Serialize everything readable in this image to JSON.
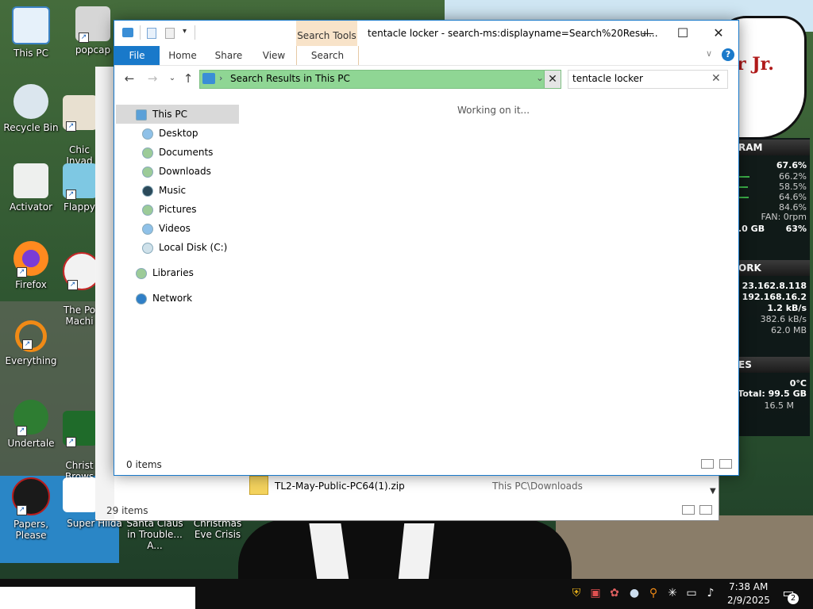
{
  "desktop": {
    "icons": [
      {
        "label": "This PC"
      },
      {
        "label": "popcap"
      },
      {
        "label": "Recycle Bin"
      },
      {
        "label": "Chic\nInvad"
      },
      {
        "label": "Activator"
      },
      {
        "label": "Flappy"
      },
      {
        "label": "Firefox"
      },
      {
        "label": "The Po\nMachi"
      },
      {
        "label": "Everything"
      },
      {
        "label": "Undertale"
      },
      {
        "label": "Christ\nBrows"
      },
      {
        "label": "Papers, Please"
      },
      {
        "label": "Super Hilda"
      },
      {
        "label": "Santa Claus in Trouble... A..."
      },
      {
        "label": "Christmas Eve Crisis"
      }
    ],
    "wallpaper_text": "r Jr."
  },
  "gadget": {
    "ram_header": "RAM",
    "ram_values": [
      "67.6%",
      "66.2%",
      "58.5%",
      "64.6%",
      "84.6%"
    ],
    "fan": "FAN: 0rpm",
    "ram_total": ".0 GB",
    "ram_pct": "63%",
    "network_header": "ORK",
    "ip1": "23.162.8.118",
    "ip2": "192.168.16.2",
    "net_down": "1.2 kB/s",
    "net_up": "382.6 kB/s",
    "net_total": "62.0 MB",
    "disks_header": "ES",
    "temp": "0°C",
    "disk_total": "Total: 99.5 GB",
    "disk_rate": "16.5 M"
  },
  "back_window": {
    "file_name": "TL2-May-Public-PC64(1).zip",
    "file_location": "This PC\\Downloads",
    "status": "29 items"
  },
  "window": {
    "title": "tentacle locker - search-ms:displayname=Search%20Resul...",
    "context_tab": "Search Tools",
    "tabs": {
      "file": "File",
      "home": "Home",
      "share": "Share",
      "view": "View",
      "search": "Search"
    },
    "minimize": "—",
    "maximize": "☐",
    "close": "✕",
    "help": "?",
    "address": "Search Results in This PC",
    "search_value": "tentacle locker",
    "nav": [
      {
        "label": "This PC",
        "color": "#5aa0d8"
      },
      {
        "label": "Desktop",
        "color": "#8fc1e8"
      },
      {
        "label": "Documents",
        "color": "#9ccb98"
      },
      {
        "label": "Downloads",
        "color": "#9ccb98"
      },
      {
        "label": "Music",
        "color": "#2b4a5a"
      },
      {
        "label": "Pictures",
        "color": "#9ccb98"
      },
      {
        "label": "Videos",
        "color": "#8fc1e8"
      },
      {
        "label": "Local Disk (C:)",
        "color": "#cfe1ea"
      },
      {
        "label": "Libraries",
        "color": "#9ccb98"
      },
      {
        "label": "Network",
        "color": "#2f7fc7"
      }
    ],
    "content_message": "Working on it...",
    "status": "0 items"
  },
  "taskbar": {
    "time": "7:38 AM",
    "date": "2/9/2025",
    "notifications": "2"
  }
}
